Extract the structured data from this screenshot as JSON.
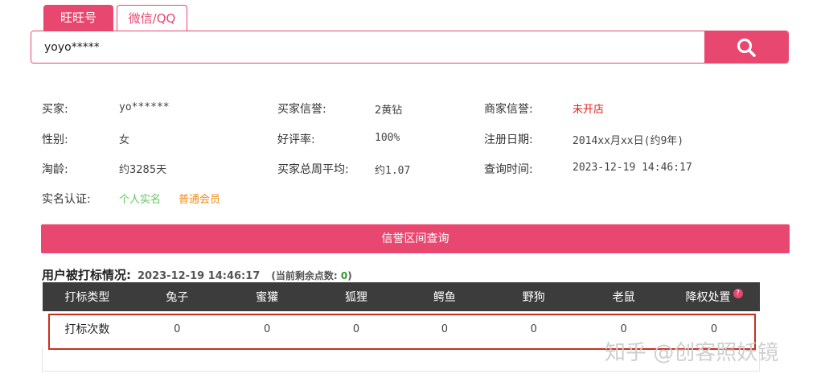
{
  "tabs": [
    {
      "label": "旺旺号"
    },
    {
      "label": "微信/QQ"
    }
  ],
  "search": {
    "value": "yoyo*****"
  },
  "profile": {
    "buyer_label": "买家:",
    "buyer_value": "yo******",
    "gender_label": "性别:",
    "gender_value": "女",
    "taobao_age_label": "淘龄:",
    "taobao_age_value": "约3285天",
    "realname_label": "实名认证:",
    "realname_value": "个人实名",
    "member_value": "普通会员",
    "buyer_credit_label": "买家信誉:",
    "buyer_credit_value": "2黄钻",
    "positive_rate_label": "好评率:",
    "positive_rate_value": "100%",
    "weekly_avg_label": "买家总周平均:",
    "weekly_avg_value": "约1.07",
    "seller_credit_label": "商家信誉:",
    "seller_credit_value": "未开店",
    "reg_date_label": "注册日期:",
    "reg_date_value": "2014xx月xx日(约9年)",
    "query_time_label": "查询时间:",
    "query_time_value": "2023-12-19 14:46:17"
  },
  "credit_button": "信誉区间查询",
  "status": {
    "title": "用户被打标情况:",
    "time": "2023-12-19 14:46:17",
    "remain_prefix": "(当前剩余点数:",
    "remain_value": "0",
    "remain_suffix": ")"
  },
  "table": {
    "headers": [
      "打标类型",
      "兔子",
      "蜜獾",
      "狐狸",
      "鳄鱼",
      "野狗",
      "老鼠",
      "降权处置"
    ],
    "row_label": "打标次数",
    "values": [
      "0",
      "0",
      "0",
      "0",
      "0",
      "0",
      "0"
    ]
  },
  "help_mark": "?",
  "watermark": "知乎 @创客照妖镜",
  "colors": {
    "accent": "#e8476f",
    "header_bg": "#3c3c3c",
    "highlight_border": "#c9301c"
  }
}
